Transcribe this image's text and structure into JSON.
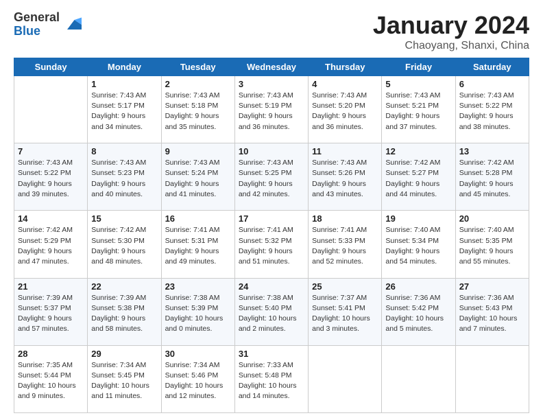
{
  "header": {
    "logo_general": "General",
    "logo_blue": "Blue",
    "month_title": "January 2024",
    "subtitle": "Chaoyang, Shanxi, China"
  },
  "days_of_week": [
    "Sunday",
    "Monday",
    "Tuesday",
    "Wednesday",
    "Thursday",
    "Friday",
    "Saturday"
  ],
  "weeks": [
    [
      {
        "day": "",
        "info": ""
      },
      {
        "day": "1",
        "info": "Sunrise: 7:43 AM\nSunset: 5:17 PM\nDaylight: 9 hours\nand 34 minutes."
      },
      {
        "day": "2",
        "info": "Sunrise: 7:43 AM\nSunset: 5:18 PM\nDaylight: 9 hours\nand 35 minutes."
      },
      {
        "day": "3",
        "info": "Sunrise: 7:43 AM\nSunset: 5:19 PM\nDaylight: 9 hours\nand 36 minutes."
      },
      {
        "day": "4",
        "info": "Sunrise: 7:43 AM\nSunset: 5:20 PM\nDaylight: 9 hours\nand 36 minutes."
      },
      {
        "day": "5",
        "info": "Sunrise: 7:43 AM\nSunset: 5:21 PM\nDaylight: 9 hours\nand 37 minutes."
      },
      {
        "day": "6",
        "info": "Sunrise: 7:43 AM\nSunset: 5:22 PM\nDaylight: 9 hours\nand 38 minutes."
      }
    ],
    [
      {
        "day": "7",
        "info": "Sunrise: 7:43 AM\nSunset: 5:22 PM\nDaylight: 9 hours\nand 39 minutes."
      },
      {
        "day": "8",
        "info": "Sunrise: 7:43 AM\nSunset: 5:23 PM\nDaylight: 9 hours\nand 40 minutes."
      },
      {
        "day": "9",
        "info": "Sunrise: 7:43 AM\nSunset: 5:24 PM\nDaylight: 9 hours\nand 41 minutes."
      },
      {
        "day": "10",
        "info": "Sunrise: 7:43 AM\nSunset: 5:25 PM\nDaylight: 9 hours\nand 42 minutes."
      },
      {
        "day": "11",
        "info": "Sunrise: 7:43 AM\nSunset: 5:26 PM\nDaylight: 9 hours\nand 43 minutes."
      },
      {
        "day": "12",
        "info": "Sunrise: 7:42 AM\nSunset: 5:27 PM\nDaylight: 9 hours\nand 44 minutes."
      },
      {
        "day": "13",
        "info": "Sunrise: 7:42 AM\nSunset: 5:28 PM\nDaylight: 9 hours\nand 45 minutes."
      }
    ],
    [
      {
        "day": "14",
        "info": "Sunrise: 7:42 AM\nSunset: 5:29 PM\nDaylight: 9 hours\nand 47 minutes."
      },
      {
        "day": "15",
        "info": "Sunrise: 7:42 AM\nSunset: 5:30 PM\nDaylight: 9 hours\nand 48 minutes."
      },
      {
        "day": "16",
        "info": "Sunrise: 7:41 AM\nSunset: 5:31 PM\nDaylight: 9 hours\nand 49 minutes."
      },
      {
        "day": "17",
        "info": "Sunrise: 7:41 AM\nSunset: 5:32 PM\nDaylight: 9 hours\nand 51 minutes."
      },
      {
        "day": "18",
        "info": "Sunrise: 7:41 AM\nSunset: 5:33 PM\nDaylight: 9 hours\nand 52 minutes."
      },
      {
        "day": "19",
        "info": "Sunrise: 7:40 AM\nSunset: 5:34 PM\nDaylight: 9 hours\nand 54 minutes."
      },
      {
        "day": "20",
        "info": "Sunrise: 7:40 AM\nSunset: 5:35 PM\nDaylight: 9 hours\nand 55 minutes."
      }
    ],
    [
      {
        "day": "21",
        "info": "Sunrise: 7:39 AM\nSunset: 5:37 PM\nDaylight: 9 hours\nand 57 minutes."
      },
      {
        "day": "22",
        "info": "Sunrise: 7:39 AM\nSunset: 5:38 PM\nDaylight: 9 hours\nand 58 minutes."
      },
      {
        "day": "23",
        "info": "Sunrise: 7:38 AM\nSunset: 5:39 PM\nDaylight: 10 hours\nand 0 minutes."
      },
      {
        "day": "24",
        "info": "Sunrise: 7:38 AM\nSunset: 5:40 PM\nDaylight: 10 hours\nand 2 minutes."
      },
      {
        "day": "25",
        "info": "Sunrise: 7:37 AM\nSunset: 5:41 PM\nDaylight: 10 hours\nand 3 minutes."
      },
      {
        "day": "26",
        "info": "Sunrise: 7:36 AM\nSunset: 5:42 PM\nDaylight: 10 hours\nand 5 minutes."
      },
      {
        "day": "27",
        "info": "Sunrise: 7:36 AM\nSunset: 5:43 PM\nDaylight: 10 hours\nand 7 minutes."
      }
    ],
    [
      {
        "day": "28",
        "info": "Sunrise: 7:35 AM\nSunset: 5:44 PM\nDaylight: 10 hours\nand 9 minutes."
      },
      {
        "day": "29",
        "info": "Sunrise: 7:34 AM\nSunset: 5:45 PM\nDaylight: 10 hours\nand 11 minutes."
      },
      {
        "day": "30",
        "info": "Sunrise: 7:34 AM\nSunset: 5:46 PM\nDaylight: 10 hours\nand 12 minutes."
      },
      {
        "day": "31",
        "info": "Sunrise: 7:33 AM\nSunset: 5:48 PM\nDaylight: 10 hours\nand 14 minutes."
      },
      {
        "day": "",
        "info": ""
      },
      {
        "day": "",
        "info": ""
      },
      {
        "day": "",
        "info": ""
      }
    ]
  ]
}
